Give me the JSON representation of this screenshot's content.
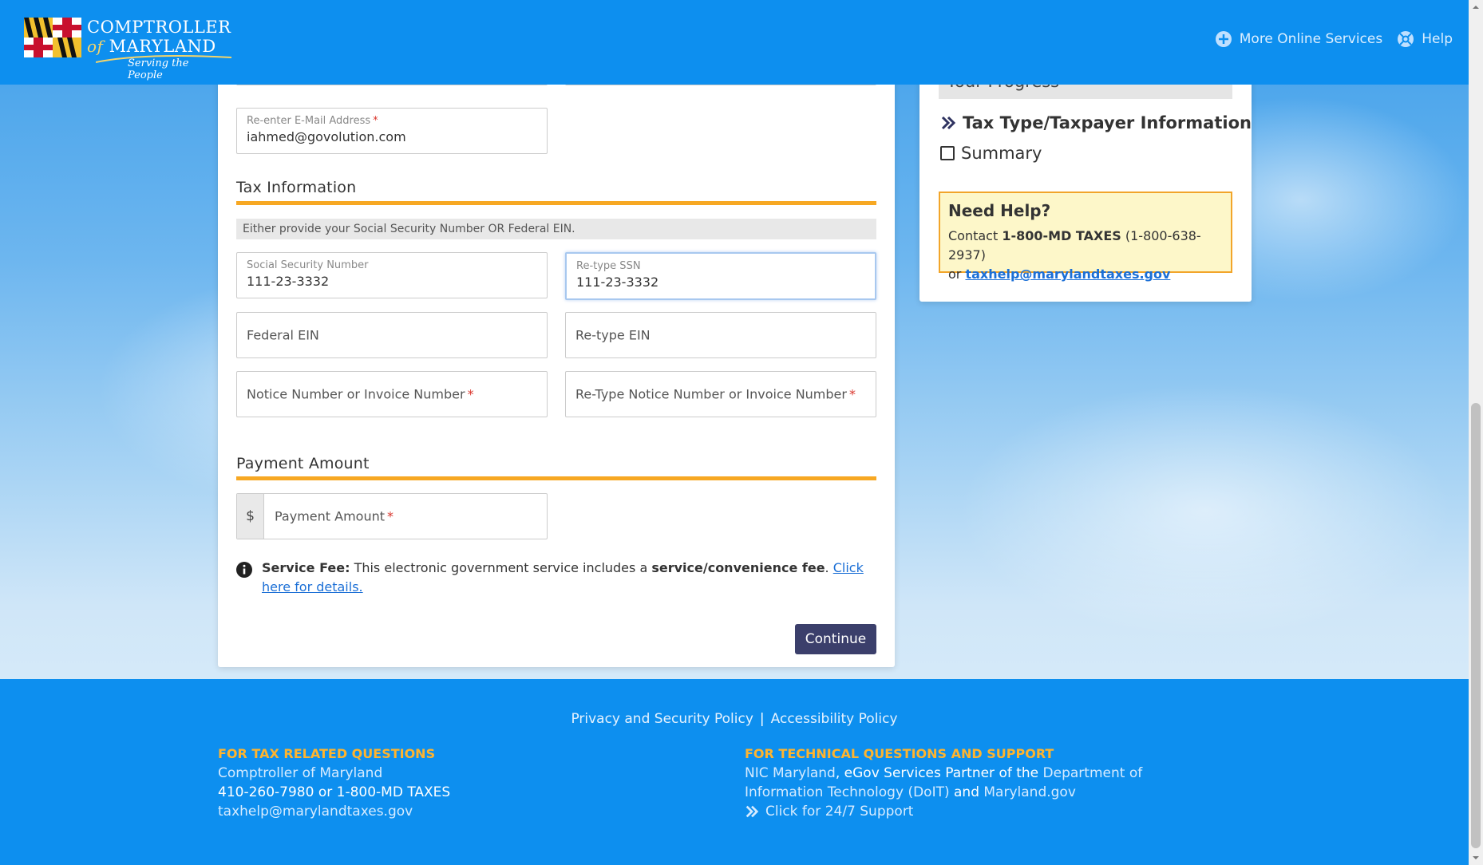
{
  "header": {
    "logo_line1": "COMPTROLLER",
    "logo_of": "of",
    "logo_line2": "MARYLAND",
    "logo_tagline": "Serving the People",
    "nav": [
      {
        "label": "More Online Services",
        "icon": "plus-circle-icon"
      },
      {
        "label": "Help",
        "icon": "lifebuoy-icon"
      }
    ]
  },
  "form": {
    "top_field_left_value": "",
    "top_field_right_value": "",
    "reenter_email": {
      "label": "Re-enter E-Mail Address",
      "required": "*",
      "value": "iahmed@govolution.com"
    },
    "tax_section_title": "Tax Information",
    "tax_note": "Either provide your Social Security Number OR Federal EIN.",
    "ssn": {
      "label": "Social Security Number",
      "value": "111-23-3332"
    },
    "ssn_retype": {
      "label": "Re-type SSN",
      "value": "111-23-3332"
    },
    "ein": {
      "placeholder": "Federal EIN"
    },
    "ein_retype": {
      "placeholder": "Re-type EIN"
    },
    "notice": {
      "placeholder": "Notice Number or Invoice Number",
      "required": "*"
    },
    "notice_retype": {
      "placeholder": "Re-Type Notice Number or Invoice Number",
      "required": "*"
    },
    "payment_section_title": "Payment Amount",
    "payment": {
      "prefix": "$",
      "placeholder": "Payment Amount",
      "required": "*"
    },
    "fee": {
      "bold_label": "Service Fee:",
      "text": "This electronic government service includes a",
      "bold_fee": "service/convenience fee",
      "period": ".",
      "link": "Click here for details."
    },
    "continue_label": "Continue"
  },
  "sidebar": {
    "progress_title": "Your Progress",
    "steps": [
      {
        "label": "Tax Type/Taxpayer Information",
        "state": "current"
      },
      {
        "label": "Summary",
        "state": "pending"
      }
    ],
    "help": {
      "title": "Need Help?",
      "contact_prefix": "Contact",
      "phone_bold": "1-800-MD TAXES",
      "phone_num": "(1-800-638-2937)",
      "or": "or",
      "email": "taxhelp@marylandtaxes.gov"
    }
  },
  "footer": {
    "links": [
      "Privacy and Security Policy",
      "Accessibility Policy"
    ],
    "separator": "|",
    "left": {
      "heading": "FOR TAX RELATED QUESTIONS",
      "line1": "Comptroller of Maryland",
      "line2": "410-260-7980 or 1-800-MD TAXES",
      "line3": "taxhelp@marylandtaxes.gov"
    },
    "right": {
      "heading": "FOR TECHNICAL QUESTIONS AND SUPPORT",
      "nic": "NIC Maryland",
      "partner": ", eGov Services Partner of the ",
      "doit": "Department of Information Technology (DoIT)",
      "and": " and ",
      "mdgov": "Maryland.gov",
      "support": "Click for 24/7 Support"
    }
  },
  "colors": {
    "header_blue": "#0d8fef",
    "accent_orange": "#f7a823",
    "button_navy": "#3b3f6b",
    "link_blue": "#1b6fd6",
    "help_bg": "#fdf7c9"
  }
}
